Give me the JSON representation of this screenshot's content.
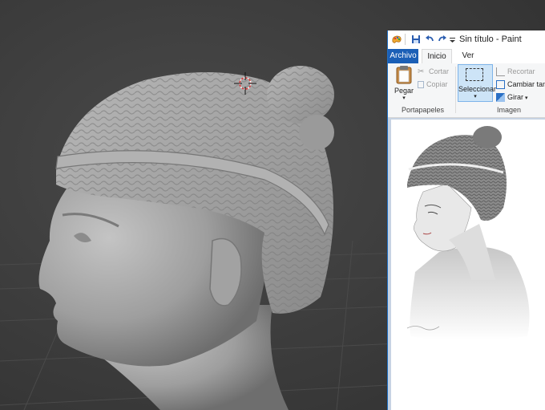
{
  "paint": {
    "title": "Sin título - Paint",
    "tabs": [
      "Archivo",
      "Inicio",
      "Ver"
    ],
    "clipboard": {
      "paste_label": "Pegar",
      "cut_label": "Cortar",
      "copy_label": "Copiar",
      "group_label": "Portapapeles"
    },
    "image": {
      "select_label": "Seleccionar",
      "crop_label": "Recortar",
      "resize_label": "Cambiar tama",
      "rotate_label": "Girar",
      "group_label": "Imagen"
    },
    "accent_color": "#1b5fb6"
  },
  "viewport": {
    "background_color": "#3a3a3a",
    "model_color": "#a9a9a9",
    "cursor_icon": "3d-cursor-icon"
  }
}
